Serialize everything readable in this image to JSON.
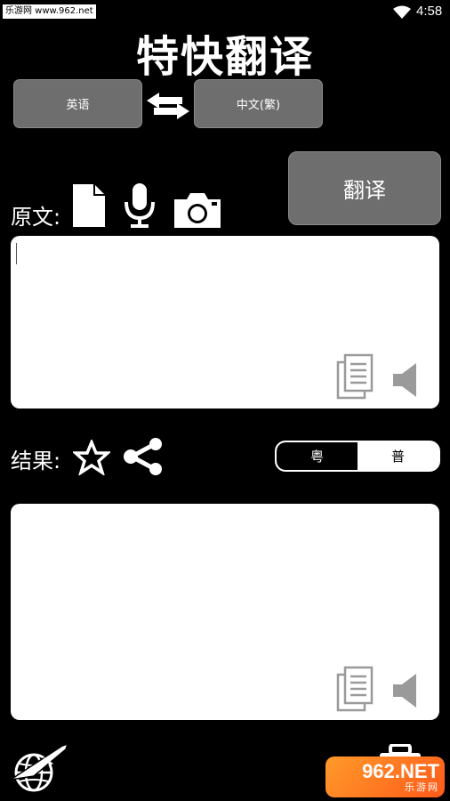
{
  "status_bar": {
    "watermark": "乐游网 www.962.net",
    "time": "4:58",
    "icons": [
      "wifi-icon"
    ]
  },
  "app": {
    "title": "特快翻译"
  },
  "languages": {
    "source": "英语",
    "target": "中文(繁)",
    "swap_icon": "swap-arrows-icon"
  },
  "actions": {
    "translate_label": "翻译"
  },
  "source_section": {
    "label": "原文:",
    "tools": [
      "file-icon",
      "microphone-icon",
      "camera-icon"
    ],
    "text": "",
    "panel_icons": [
      "copy-icon",
      "speaker-icon"
    ]
  },
  "result_section": {
    "label": "结果:",
    "tools": [
      "star-icon",
      "share-icon"
    ],
    "text": "",
    "panel_icons": [
      "copy-icon",
      "speaker-icon"
    ]
  },
  "dialect": {
    "options": [
      "粤",
      "普"
    ],
    "selected": "粤"
  },
  "footer": {
    "badge_main": "962.NET",
    "badge_sub": "乐游网"
  },
  "colors": {
    "background": "#000000",
    "button_gray": "#6e6e6e",
    "panel": "#ffffff",
    "icon_gray": "#9a9a9a",
    "badge_orange": "#ff7a22"
  }
}
